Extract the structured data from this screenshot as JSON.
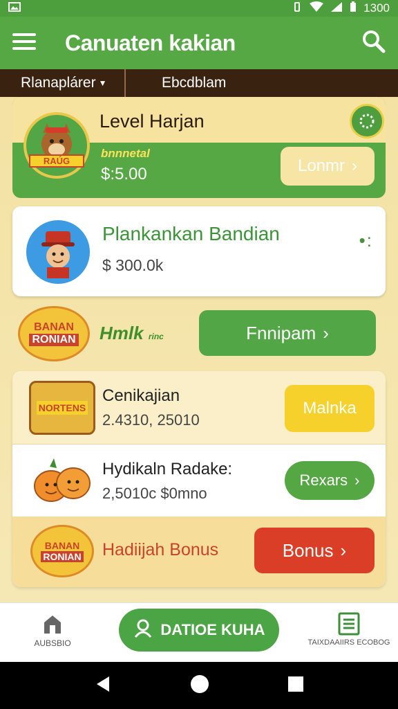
{
  "status": {
    "time": "1300"
  },
  "appbar": {
    "title": "Canuaten kakian",
    "menu_icon": "menu-icon",
    "search_icon": "search-icon"
  },
  "subbar": {
    "item1": "Rlanaplárer",
    "item2": "Ebcdblam"
  },
  "level_card": {
    "title": "Level Harjan",
    "badge": "RAÚG",
    "small_label": "bnnnetal",
    "amount": "$:5.00",
    "button": "Lonmr"
  },
  "profile_card": {
    "name": "Plankankan Bandian",
    "amount": "$ 300.0k"
  },
  "promo": {
    "badge_line1": "BANAN",
    "badge_line2": "RONIAN",
    "tag": "Hmlk",
    "tag_small": "rinc",
    "button": "Fnnipam"
  },
  "list": [
    {
      "title": "Cenikajian",
      "subtitle": "2.4310, 25010",
      "button": "Malnka",
      "badge": "NORTENS"
    },
    {
      "title": "Hydikaln Radake:",
      "subtitle": "2,5010c $0mno",
      "button": "Rexars"
    },
    {
      "title": "Hadiijah Bonus",
      "button": "Bonus",
      "badge_line1": "BANAN",
      "badge_line2": "RONIAN"
    }
  ],
  "bottom_nav": {
    "left_label": "AUBSBIO",
    "center_label": "DATIOE KUHA",
    "right_label": "TAIXDAAIIRS ECOBOG"
  },
  "colors": {
    "green": "#56a845",
    "dark": "#3a2211",
    "yellow": "#f6d12b",
    "red": "#db3e26"
  }
}
